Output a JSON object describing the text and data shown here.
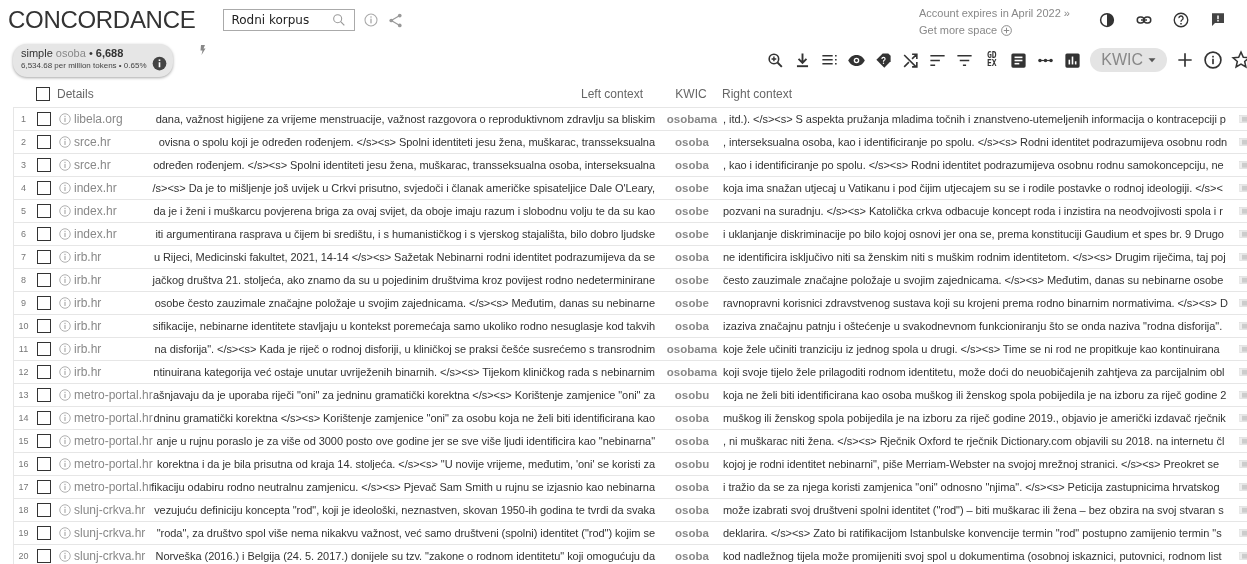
{
  "header": {
    "title": "CONCORDANCE",
    "search": {
      "value": "Rodni korpus"
    },
    "account_notice": "Account expires in April 2022 »",
    "more_space": "Get more space"
  },
  "summary": {
    "type": "simple",
    "query": "osoba",
    "separator": "•",
    "hits": "6,688",
    "detail": "6,534.68 per million tokens • 0.65%"
  },
  "toolbar": {
    "gdex_label": [
      "GD",
      "EX"
    ],
    "view_select": "KWIC"
  },
  "table": {
    "select_all": {
      "checked": false
    },
    "columns": [
      "Details",
      "Left context",
      "KWIC",
      "Right context"
    ],
    "rows": [
      {
        "number": "1",
        "checked": false,
        "source": "libela.org",
        "left": "dana, važnost higijene za vrijeme menstruacije, važnost razgovora o reproduktivnom zdravlju sa bliskim",
        "kwic": "osobama",
        "right": ", itd.). </s><s> S aspekta pružanja mladima točnih i znanstveno-utemeljenih informacija o kontracepciji p"
      },
      {
        "number": "2",
        "checked": false,
        "source": "srce.hr",
        "left": "ovisna o spolu koji je određen rođenjem. </s><s> Spolni identiteti jesu žena, muškarac, transseksualna",
        "kwic": "osoba",
        "right": ", interseksualna osoba, kao i identificiranje po spolu. </s><s> Rodni identitet podrazumijeva osobnu rodn"
      },
      {
        "number": "3",
        "checked": false,
        "source": "srce.hr",
        "left": "određen rođenjem. </s><s> Spolni identiteti jesu žena, muškarac, transseksualna osoba, interseksualna",
        "kwic": "osoba",
        "right": ", kao i identificiranje po spolu. </s><s> Rodni identitet podrazumijeva osobnu rodnu samokoncepciju, ne"
      },
      {
        "number": "4",
        "checked": false,
        "source": "index.hr",
        "left": "/s><s> Da je to mišljenje još uvijek u Crkvi prisutno, svjedoči i članak američke spisateljice Dale O'Leary,",
        "kwic": "osobe",
        "right": "koja ima snažan utjecaj u Vatikanu i pod čijim utjecajem su se i rodile postavke o rodnoj ideologiji. </s><"
      },
      {
        "number": "5",
        "checked": false,
        "source": "index.hr",
        "left": "da je i ženi i muškarcu povjerena briga za ovaj svijet, da oboje imaju razum i slobodnu volju te da su kao",
        "kwic": "osobe",
        "right": "pozvani na suradnju. </s><s> Katolička crkva odbacuje koncept roda i inzistira na neodvojivosti spola i r"
      },
      {
        "number": "6",
        "checked": false,
        "source": "index.hr",
        "left": "iti argumentirana rasprava u čijem bi središtu, i s humanističkog i s vjerskog stajališta, bilo dobro ljudske",
        "kwic": "osobe",
        "right": "i uklanjanje diskriminacije po bilo kojoj osnovi jer ona se, prema konstituciji Gaudium et spes br. 9 Drugo"
      },
      {
        "number": "7",
        "checked": false,
        "source": "irb.hr",
        "left": "u Rijeci, Medicinski fakultet, 2021, 14-14 </s><s> Sažetak Nebinarni rodni identitet podrazumijeva da se",
        "kwic": "osoba",
        "right": "ne identificira isključivo niti sa ženskim niti s muškim rodnim identitetom. </s><s> Drugim riječima, taj poj"
      },
      {
        "number": "8",
        "checked": false,
        "source": "irb.hr",
        "left": "jačkog društva 21. stoljeća, ako znamo da su u pojedinim društvima kroz povijest rodno nedeterminirane",
        "kwic": "osobe",
        "right": "često zauzimale značajne položaje u svojim zajednicama. </s><s> Međutim, danas su nebinarne osobe"
      },
      {
        "number": "9",
        "checked": false,
        "source": "irb.hr",
        "left": "osobe često zauzimale značajne položaje u svojim zajednicama. </s><s> Međutim, danas su nebinarne",
        "kwic": "osobe",
        "right": "ravnopravni korisnici zdravstvenog sustava koji su krojeni prema rodno binarnim normativima. </s><s> D"
      },
      {
        "number": "10",
        "checked": false,
        "source": "irb.hr",
        "left": "sifikacije, nebinarne identitete stavljaju u kontekst poremećaja samo ukoliko rodno nesuglasje kod takvih",
        "kwic": "osoba",
        "right": "izaziva značajnu patnju i oštećenje u svakodnevnom funkcioniranju što se onda naziva \"rodna disforija\"."
      },
      {
        "number": "11",
        "checked": false,
        "source": "irb.hr",
        "left": "na disforija\". </s><s> Kada je riječ o rodnoj disforiji, u kliničkoj se praksi češće susrećemo s transrodnim",
        "kwic": "osobama",
        "right": "koje žele učiniti tranziciju iz jednog spola u drugi. </s><s> Time se ni rod ne propitkuje kao kontinuirana"
      },
      {
        "number": "12",
        "checked": false,
        "source": "irb.hr",
        "left": "ntinuirana kategorija već ostaje unutar uvriježenih binarnih. </s><s> Tijekom kliničkog rada s nebinarnim",
        "kwic": "osobama",
        "right": "koji svoje tijelo žele prilagoditi rodnom identitetu, može doći do neuobičajenih zahtjeva za parcijalnim obl"
      },
      {
        "number": "13",
        "checked": false,
        "source": "metro-portal.hr",
        "left": "ašnjavaju da je uporaba riječi \"oni\" za jedninu gramatički korektna </s><s> Korištenje zamjenice \"oni\" za",
        "kwic": "osobu",
        "right": "koja ne želi biti identificirana kao osoba muškog ili ženskog spola pobijedila je na izboru za riječ godine 2"
      },
      {
        "number": "14",
        "checked": false,
        "source": "metro-portal.hr",
        "left": "dninu gramatički korektna </s><s> Korištenje zamjenice \"oni\" za osobu koja ne želi biti identificirana kao",
        "kwic": "osoba",
        "right": "muškog ili ženskog spola pobijedila je na izboru za riječ godine 2019., objavio je američki izdavač rječnik"
      },
      {
        "number": "15",
        "checked": false,
        "source": "metro-portal.hr",
        "left": "anje u rujnu poraslo je za više od 3000 posto ove godine jer se sve više ljudi identificira kao \"nebinarna\"",
        "kwic": "osoba",
        "right": ", ni muškarac niti žena. </s><s> Rječnik Oxford te rječnik Dictionary.com objavili su 2018. na internetu čl"
      },
      {
        "number": "16",
        "checked": false,
        "source": "metro-portal.hr",
        "left": "korektna i da je bila prisutna od kraja 14. stoljeća. </s><s> \"U novije vrijeme, međutim, 'oni' se koristi za",
        "kwic": "osobu",
        "right": "kojoj je rodni identitet nebinarni\", piše Merriam-Webster na svojoj mrežnoj stranici. </s><s> Preokret se"
      },
      {
        "number": "17",
        "checked": false,
        "source": "metro-portal.hr",
        "left": "fikaciju odabiru rodno neutralnu zamjenicu. </s><s> Pjevač Sam Smith u rujnu se izjasnio kao nebinarna",
        "kwic": "osoba",
        "right": "i tražio da se za njega koristi zamjenica \"oni\" odnosno \"njima\". </s><s> Peticija zastupnicima hrvatskog"
      },
      {
        "number": "18",
        "checked": false,
        "source": "slunj-crkva.hr",
        "left": "vezujuću definiciju koncepta \"rod\", koji je ideološki, neznastven, skovan 1950-ih godina te tvrdi da svaka",
        "kwic": "osoba",
        "right": "može izabrati svoj društveni spolni identitet (\"rod\") – biti muškarac ili žena – bez obzira na svoj stvaran s"
      },
      {
        "number": "19",
        "checked": false,
        "source": "slunj-crkva.hr",
        "left": "\"roda\", za društvo spol više nema nikakvu važnost, već samo društveni (spolni) identitet (\"rod\") kojim se",
        "kwic": "osoba",
        "right": "deklarira. </s><s> Zato bi ratifikacijom Istanbulske konvencije termin \"rod\" postupno zamijenio termin \"s"
      },
      {
        "number": "20",
        "checked": false,
        "source": "slunj-crkva.hr",
        "left": "Norveška (2016.) i Belgija (24. 5. 2017.) donijele su tzv. \"zakone o rodnom identitetu\" koji omogućuju da",
        "kwic": "osoba",
        "right": "kod nadležnog tijela može promijeniti svoj spol u dokumentima (osobnoj iskaznici, putovnici, rodnom list"
      }
    ]
  }
}
